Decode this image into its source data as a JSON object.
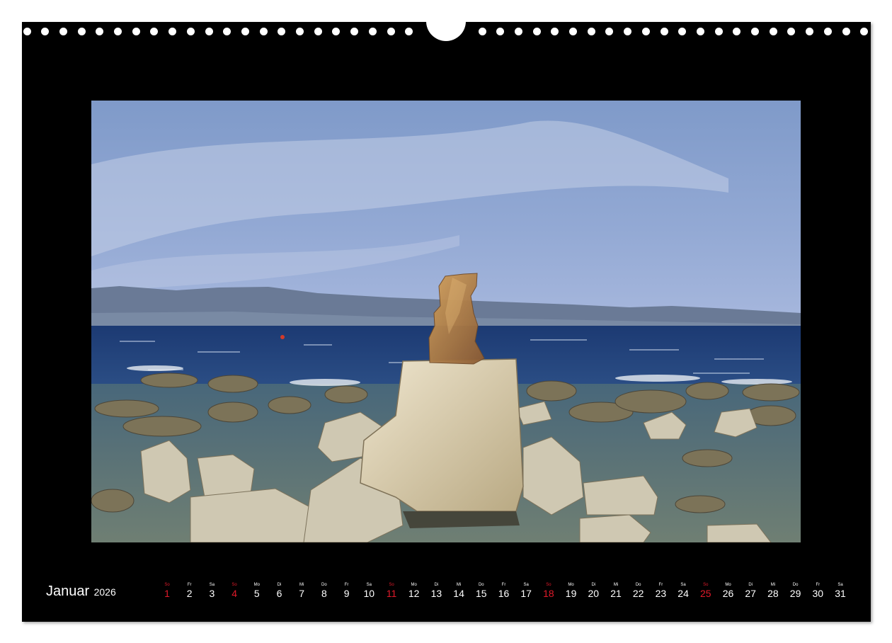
{
  "calendar": {
    "month": "Januar",
    "year": "2026",
    "days": [
      {
        "wd": "So",
        "d": "1",
        "sunday": true
      },
      {
        "wd": "Fr",
        "d": "2"
      },
      {
        "wd": "Sa",
        "d": "3"
      },
      {
        "wd": "So",
        "d": "4",
        "sunday": true
      },
      {
        "wd": "Mo",
        "d": "5"
      },
      {
        "wd": "Di",
        "d": "6"
      },
      {
        "wd": "Mi",
        "d": "7"
      },
      {
        "wd": "Do",
        "d": "8"
      },
      {
        "wd": "Fr",
        "d": "9"
      },
      {
        "wd": "Sa",
        "d": "10"
      },
      {
        "wd": "So",
        "d": "11",
        "sunday": true
      },
      {
        "wd": "Mo",
        "d": "12"
      },
      {
        "wd": "Di",
        "d": "13"
      },
      {
        "wd": "Mi",
        "d": "14"
      },
      {
        "wd": "Do",
        "d": "15"
      },
      {
        "wd": "Fr",
        "d": "16"
      },
      {
        "wd": "Sa",
        "d": "17"
      },
      {
        "wd": "So",
        "d": "18",
        "sunday": true
      },
      {
        "wd": "Mo",
        "d": "19"
      },
      {
        "wd": "Di",
        "d": "20"
      },
      {
        "wd": "Mi",
        "d": "21"
      },
      {
        "wd": "Do",
        "d": "22"
      },
      {
        "wd": "Fr",
        "d": "23"
      },
      {
        "wd": "Sa",
        "d": "24"
      },
      {
        "wd": "So",
        "d": "25",
        "sunday": true
      },
      {
        "wd": "Mo",
        "d": "26"
      },
      {
        "wd": "Di",
        "d": "27"
      },
      {
        "wd": "Mi",
        "d": "28"
      },
      {
        "wd": "Do",
        "d": "29"
      },
      {
        "wd": "Fr",
        "d": "30"
      },
      {
        "wd": "Sa",
        "d": "31"
      }
    ]
  },
  "colors": {
    "background": "#000000",
    "sunday": "#e01a2a",
    "text": "#ffffff"
  }
}
